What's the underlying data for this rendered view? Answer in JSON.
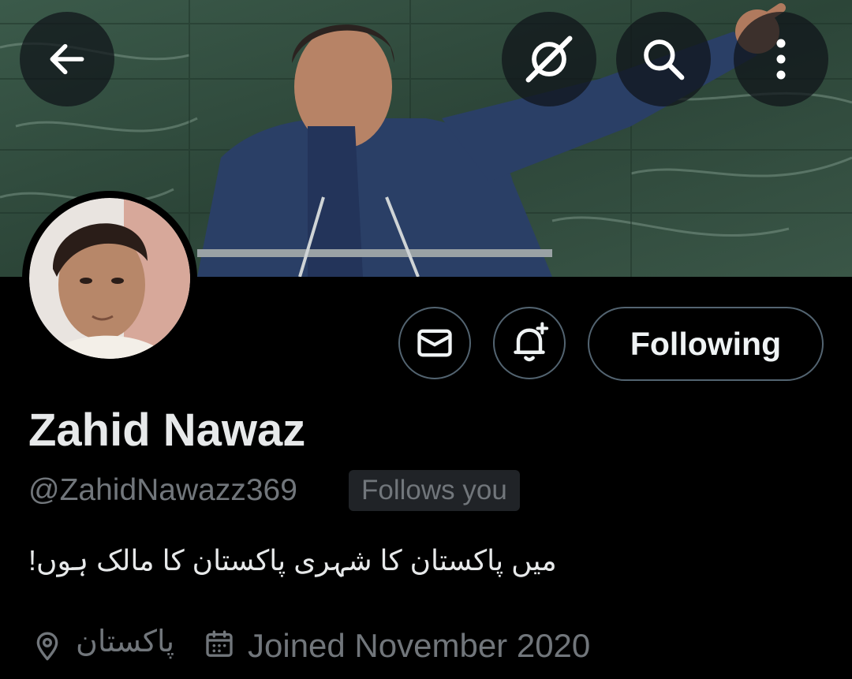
{
  "header": {
    "back_icon": "arrow-left-icon",
    "grok_icon": "grok-icon",
    "search_icon": "search-icon",
    "more_icon": "more-vertical-icon"
  },
  "profile": {
    "display_name": "Zahid Nawaz",
    "handle": "@ZahidNawazz369",
    "follows_you_badge": "Follows you",
    "bio": "میں پاکستان کا شہری پاکستان کا مالک ہوں!",
    "location": "پاکستان",
    "joined": "Joined November 2020"
  },
  "actions": {
    "message_icon": "mail-icon",
    "notify_icon": "bell-plus-icon",
    "following_label": "Following"
  },
  "colors": {
    "background": "#000000",
    "primary_text": "#e7e9ea",
    "secondary_text": "#71767b",
    "border": "#536471",
    "badge_bg": "#202327"
  }
}
